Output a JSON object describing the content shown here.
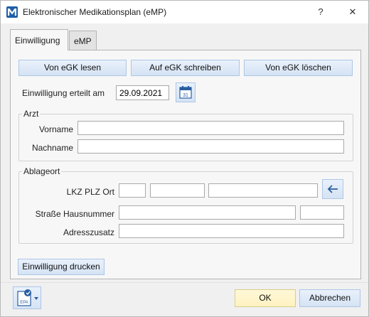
{
  "window": {
    "title": "Elektronischer Medikationsplan (eMP)",
    "help_glyph": "?",
    "close_glyph": "✕"
  },
  "tabs": [
    {
      "label": "Einwilligung",
      "active": true
    },
    {
      "label": "eMP",
      "active": false
    }
  ],
  "egk_buttons": {
    "read_label": "Von eGK lesen",
    "write_label": "Auf eGK schreiben",
    "delete_label": "Von eGK löschen"
  },
  "consent": {
    "label": "Einwilligung erteilt am",
    "date_value": "29.09.2021",
    "calendar_day": "31"
  },
  "arzt": {
    "legend": "Arzt",
    "vorname_label": "Vorname",
    "vorname_value": "",
    "nachname_label": "Nachname",
    "nachname_value": ""
  },
  "ablageort": {
    "legend": "Ablageort",
    "lkz_label": "LKZ PLZ Ort",
    "lkz_value": "",
    "plz_value": "",
    "ort_value": "",
    "strasse_label": "Straße Hausnummer",
    "strasse_value": "",
    "hausnummer_value": "",
    "adresszusatz_label": "Adresszusatz",
    "adresszusatz_value": ""
  },
  "print_button_label": "Einwilligung drucken",
  "footer": {
    "epa_icon_text": "EPA",
    "ok_label": "OK",
    "cancel_label": "Abbrechen"
  },
  "colors": {
    "button_border": "#adc6e6",
    "button_fill": "#dbe7f6",
    "ok_fill": "#fff5cc",
    "app_icon": "#1f5fa8"
  }
}
